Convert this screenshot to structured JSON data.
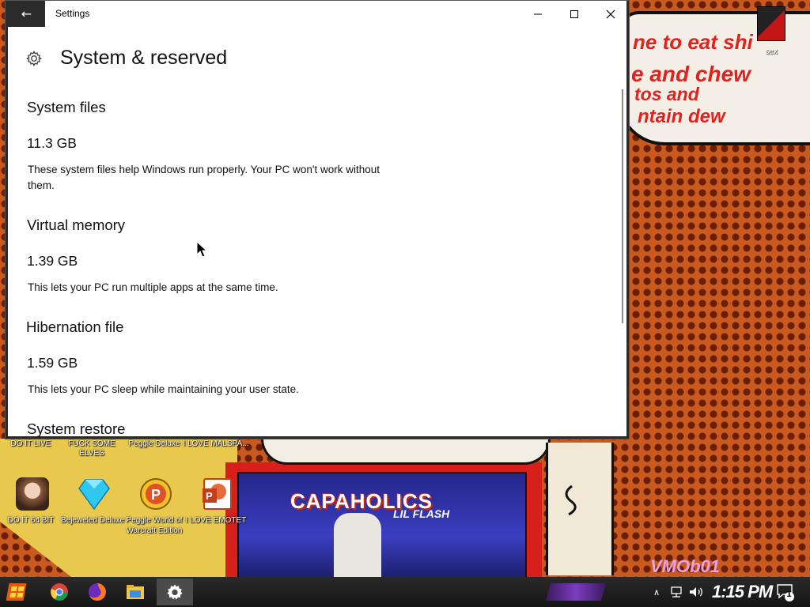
{
  "window": {
    "app_title": "Settings",
    "page_title": "System & reserved",
    "controls": {
      "minimize": "—",
      "maximize": "☐",
      "close": "✕"
    }
  },
  "sections": [
    {
      "title": "System files",
      "size": "11.3 GB",
      "description": "These system files help Windows run properly. Your PC won't work without them."
    },
    {
      "title": "Virtual memory",
      "size": "1.39 GB",
      "description": "This lets your PC run multiple apps at the same time."
    },
    {
      "title": "Hibernation file",
      "size": "1.59 GB",
      "description": "This lets your PC sleep while maintaining your user state."
    },
    {
      "title": "System restore"
    }
  ],
  "desktop": {
    "top_row_labels": [
      "DO IT LIVE",
      "FUCK SOME ELVES",
      "Peggle Deluxe",
      "I LOVE MALSPA..."
    ],
    "icons": [
      {
        "label": "DO IT 64 BIT",
        "icon": "portrait-icon"
      },
      {
        "label": "Bejeweled Deluxe",
        "icon": "diamond-icon"
      },
      {
        "label": "Peggle World of Warcraft Edition",
        "icon": "peggle-icon"
      },
      {
        "label": "I LOVE EMOTET",
        "icon": "powerpoint-icon"
      }
    ],
    "corner_icon_label": "sex",
    "wallpaper_text": [
      "ne to eat shi",
      "e and chew",
      "tos and",
      "ntain dew"
    ],
    "album_text": "CAPAHOLICS",
    "album_sub": "LIL FLASH",
    "wallpaper_tag": "VMOb01"
  },
  "taskbar": {
    "clock": "1:15 PM",
    "notification_count": "1",
    "apps": [
      "chrome-icon",
      "firefox-icon",
      "file-explorer-icon",
      "settings-icon"
    ]
  },
  "colors": {
    "accent_dark": "#2b2b2b",
    "wallpaper_orange": "#c95a1f"
  }
}
